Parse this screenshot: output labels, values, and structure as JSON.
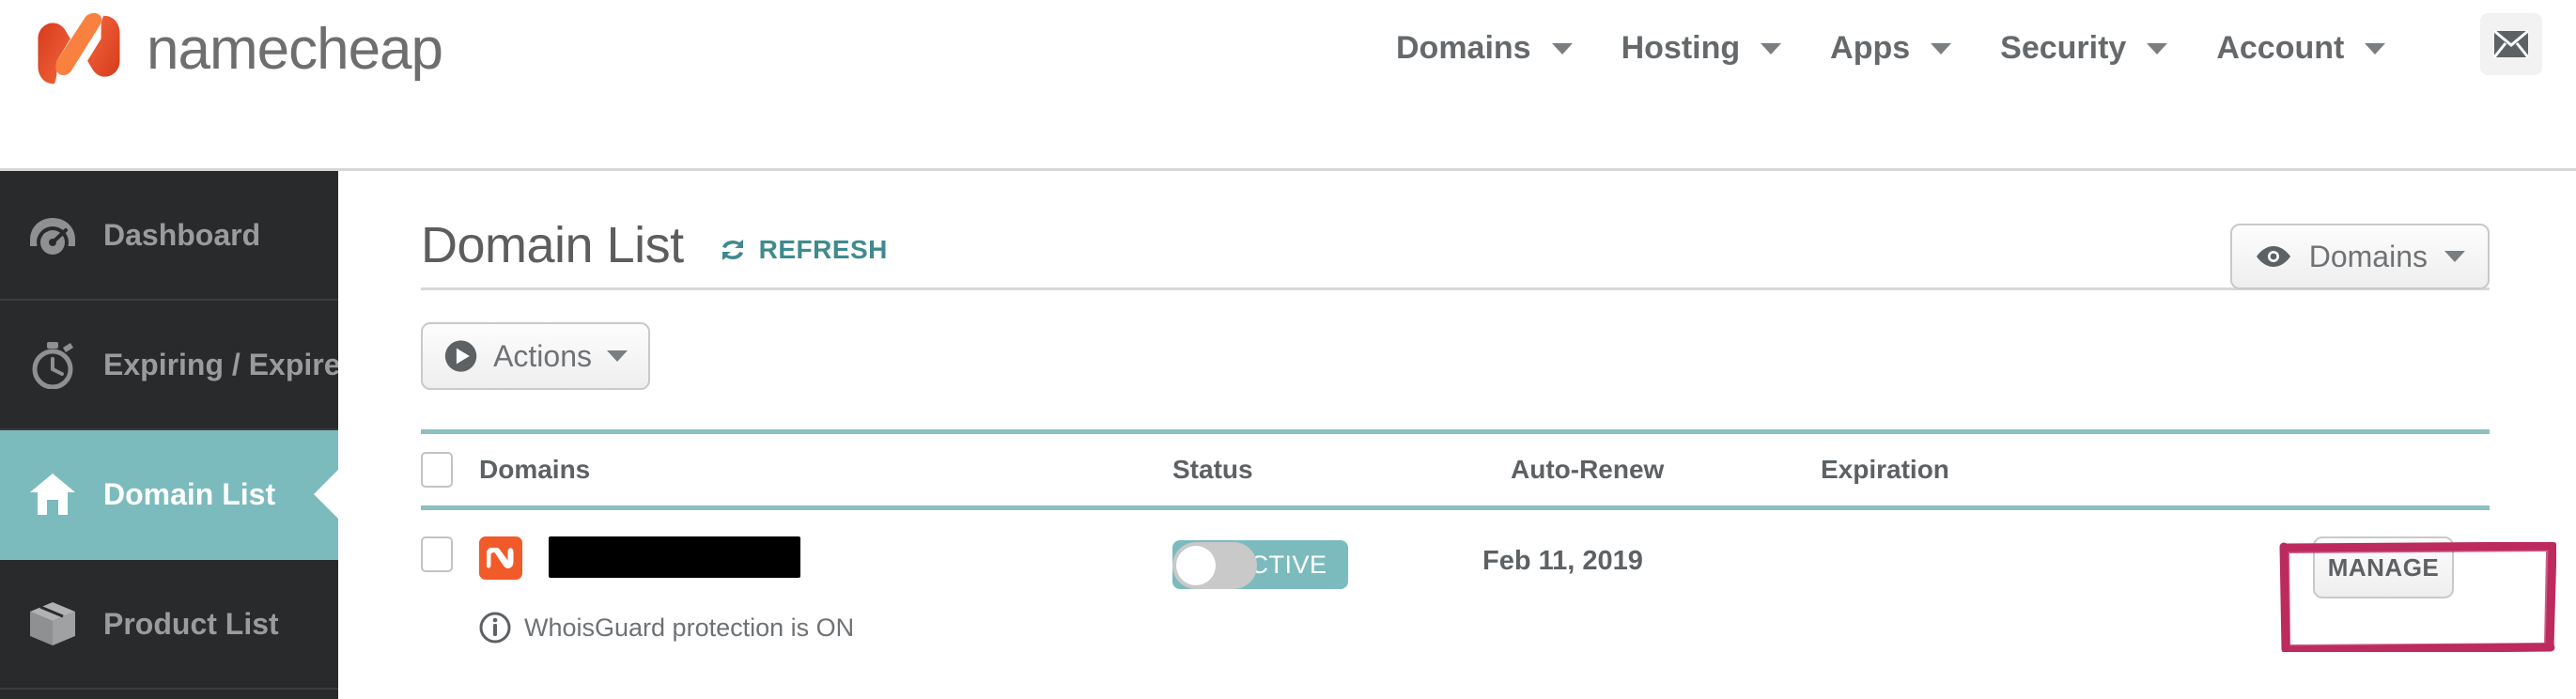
{
  "brand": {
    "name": "namecheap",
    "logo_icon": "namecheap-logo",
    "logo_color": "#f1592a"
  },
  "topnav": {
    "items": [
      {
        "label": "Domains",
        "icon": "chevron-down-icon"
      },
      {
        "label": "Hosting",
        "icon": "chevron-down-icon"
      },
      {
        "label": "Apps",
        "icon": "chevron-down-icon"
      },
      {
        "label": "Security",
        "icon": "chevron-down-icon"
      },
      {
        "label": "Account",
        "icon": "chevron-down-icon"
      }
    ],
    "mail_icon": "envelope-icon"
  },
  "sidebar": {
    "active_color": "#7cbbbd",
    "background": "#282a2b",
    "items": [
      {
        "label": "Dashboard",
        "icon": "speedometer-icon",
        "active": false
      },
      {
        "label": "Expiring / Expired",
        "icon": "stopwatch-icon",
        "active": false
      },
      {
        "label": "Domain List",
        "icon": "house-icon",
        "active": true
      },
      {
        "label": "Product List",
        "icon": "box-icon",
        "active": false
      }
    ]
  },
  "main": {
    "page_title": "Domain List",
    "refresh_label": "REFRESH",
    "refresh_icon": "refresh-icon",
    "refresh_color": "#3f8a8c",
    "view_filter": {
      "label": "Domains",
      "icon": "eye-icon",
      "caret": "chevron-down-icon"
    },
    "actions_button": {
      "label": "Actions",
      "icon": "play-circle-icon",
      "caret": "chevron-down-icon"
    },
    "table": {
      "header_accent": "#8cbfc0",
      "columns": [
        "Domains",
        "Status",
        "Auto-Renew",
        "Expiration",
        ""
      ],
      "rows": [
        {
          "select_checkbox": "unchecked",
          "favicon": "namecheap-favicon",
          "domain_name": "",
          "domain_redacted": true,
          "note_icon": "info-icon",
          "note": "WhoisGuard protection is ON",
          "status": "ACTIVE",
          "status_icon": "check-icon",
          "status_color": "#7cbbbd",
          "auto_renew": "off",
          "expiration": "Feb 11, 2019",
          "manage_label": "MANAGE"
        }
      ]
    }
  },
  "annotation": {
    "shape": "rough-rectangle-highlight",
    "color": "#bc2a5e",
    "target": "manage-button"
  }
}
